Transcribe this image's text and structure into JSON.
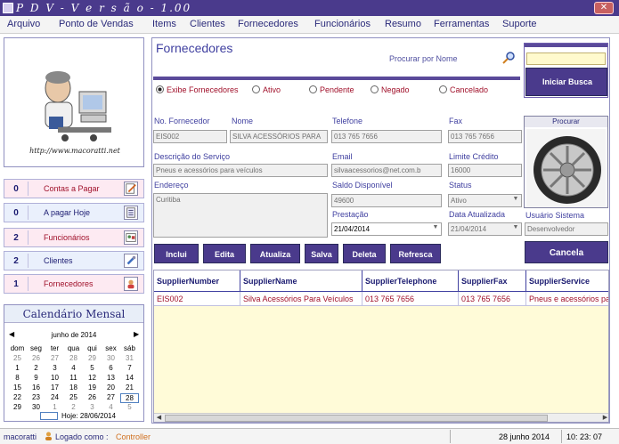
{
  "window": {
    "title": "P D V  - V e r s ã o  - 1.00"
  },
  "menu": [
    "Arquivo",
    "Ponto de Vendas",
    "Items",
    "Clientes",
    "Fornecedores",
    "Funcionários",
    "Resumo",
    "Ferramentas",
    "Suporte"
  ],
  "logo": {
    "url": "http://www.macoratti.net"
  },
  "summary": [
    {
      "count": "0",
      "label": "Contas a Pagar"
    },
    {
      "count": "0",
      "label": "A pagar Hoje"
    },
    {
      "count": "2",
      "label": "Funcionários"
    },
    {
      "count": "2",
      "label": "Clientes"
    },
    {
      "count": "1",
      "label": "Fornecedores"
    }
  ],
  "calendar": {
    "title": "Calendário Mensal",
    "month": "junho de 2014",
    "weekdays": [
      "dom",
      "seg",
      "ter",
      "qua",
      "qui",
      "sex",
      "sáb"
    ],
    "weeks": [
      [
        "25",
        "26",
        "27",
        "28",
        "29",
        "30",
        "31"
      ],
      [
        "1",
        "2",
        "3",
        "4",
        "5",
        "6",
        "7"
      ],
      [
        "8",
        "9",
        "10",
        "11",
        "12",
        "13",
        "14"
      ],
      [
        "15",
        "16",
        "17",
        "18",
        "19",
        "20",
        "21"
      ],
      [
        "22",
        "23",
        "24",
        "25",
        "26",
        "27",
        "28"
      ],
      [
        "29",
        "30",
        "1",
        "2",
        "3",
        "4",
        "5"
      ]
    ],
    "today_label": "Hoje: 28/06/2014"
  },
  "form": {
    "title": "Fornecedores",
    "search_label": "Procurar por Nome",
    "search_button": "Iniciar Busca",
    "filters": [
      "Exibe Fornecedores",
      "Ativo",
      "Pendente",
      "Negado",
      "Cancelado"
    ],
    "labels": {
      "no_fornecedor": "No. Fornecedor",
      "nome": "Nome",
      "telefone": "Telefone",
      "fax": "Fax",
      "descricao": "Descrição do Serviço",
      "email": "Email",
      "limite": "Limite Crédito",
      "endereco": "Endereço",
      "saldo": "Saldo Disponível",
      "status": "Status",
      "prestacao": "Prestação",
      "data_atualizada": "Data Atualizada",
      "usuario": "Usuário Sistema",
      "photo": "Procurar"
    },
    "values": {
      "no_fornecedor": "EIS002",
      "nome": "SILVA ACESSÓRIOS PARA",
      "telefone": "013 765 7656",
      "fax": "013 765 7656",
      "descricao": "Pneus e acessórios para veículos",
      "email": "silvaacessorios@net.com.b",
      "limite": "16000",
      "endereco": "Curitiba",
      "saldo": "49600",
      "status": "Ativo",
      "prestacao": "21/04/2014",
      "data_atualizada": "21/04/2014",
      "usuario": "Desenvolvedor"
    },
    "buttons": [
      "Inclui",
      "Edita",
      "Atualiza",
      "Salva",
      "Deleta",
      "Refresca"
    ],
    "cancel": "Cancela"
  },
  "grid": {
    "columns": [
      "SupplierNumber",
      "SupplierName",
      "SupplierTelephone",
      "SupplierFax",
      "SupplierService"
    ],
    "rows": [
      [
        "EIS002",
        "Silva Acessórios Para Veículos",
        "013 765 7656",
        "013 765 7656",
        "Pneus e acessórios pa"
      ]
    ]
  },
  "status": {
    "user": "macoratti",
    "logged": "Logado como :",
    "role": "Controller",
    "date": "28  junho  2014",
    "time": "10: 23: 07"
  }
}
